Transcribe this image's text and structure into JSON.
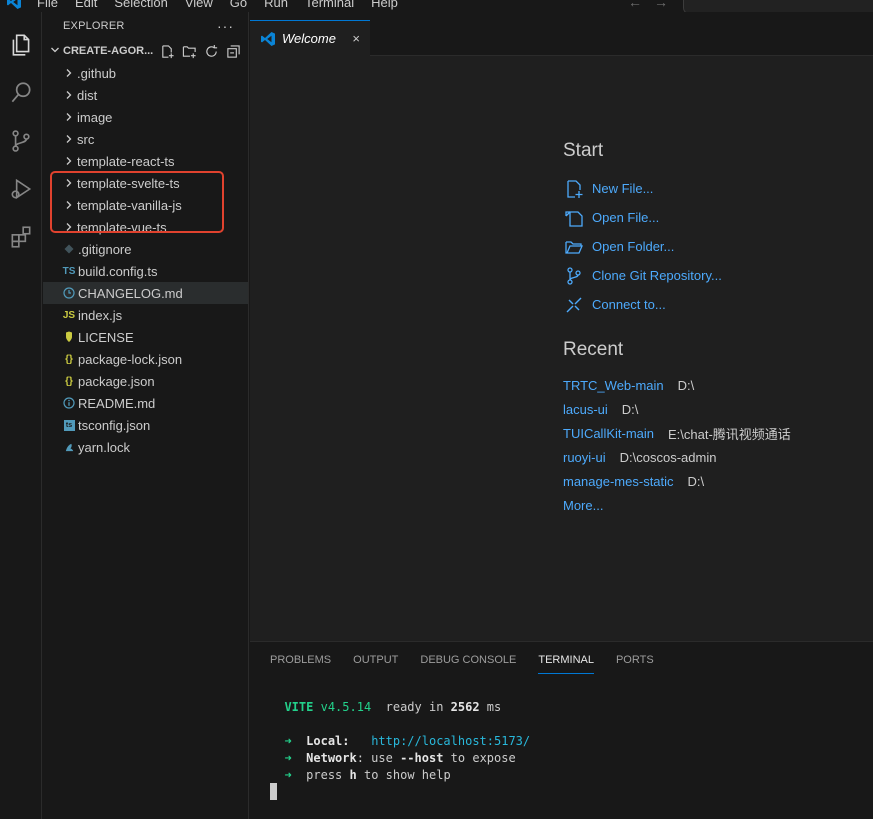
{
  "menu": [
    "File",
    "Edit",
    "Selection",
    "View",
    "Go",
    "Run",
    "Terminal",
    "Help"
  ],
  "explorer": {
    "header": "EXPLORER",
    "more": "···",
    "folder": "CREATE-AGOR...",
    "items": [
      {
        "label": ".github",
        "type": "folder"
      },
      {
        "label": "dist",
        "type": "folder"
      },
      {
        "label": "image",
        "type": "folder"
      },
      {
        "label": "src",
        "type": "folder"
      },
      {
        "label": "template-react-ts",
        "type": "folder"
      },
      {
        "label": "template-svelte-ts",
        "type": "folder"
      },
      {
        "label": "template-vanilla-js",
        "type": "folder"
      },
      {
        "label": "template-vue-ts",
        "type": "folder"
      },
      {
        "label": ".gitignore",
        "type": "file",
        "icon": "git-icon"
      },
      {
        "label": "build.config.ts",
        "type": "file",
        "icon": "TS"
      },
      {
        "label": "CHANGELOG.md",
        "type": "file",
        "icon": "clock-icon"
      },
      {
        "label": "index.js",
        "type": "file",
        "icon": "JS"
      },
      {
        "label": "LICENSE",
        "type": "file",
        "icon": "license-icon"
      },
      {
        "label": "package-lock.json",
        "type": "file",
        "icon": "{}"
      },
      {
        "label": "package.json",
        "type": "file",
        "icon": "{}"
      },
      {
        "label": "README.md",
        "type": "file",
        "icon": "info-icon"
      },
      {
        "label": "tsconfig.json",
        "type": "file",
        "icon": "ts"
      },
      {
        "label": "yarn.lock",
        "type": "file",
        "icon": "yarn-icon"
      }
    ]
  },
  "editor": {
    "tab_label": "Welcome",
    "tab_close": "×",
    "start_title": "Start",
    "start_items": [
      {
        "label": "New File...",
        "icon": "new-file-icon"
      },
      {
        "label": "Open File...",
        "icon": "open-file-icon"
      },
      {
        "label": "Open Folder...",
        "icon": "open-folder-icon"
      },
      {
        "label": "Clone Git Repository...",
        "icon": "git-clone-icon"
      },
      {
        "label": "Connect to...",
        "icon": "remote-icon"
      }
    ],
    "recent_title": "Recent",
    "recent_items": [
      {
        "name": "TRTC_Web-main",
        "path": "D:\\"
      },
      {
        "name": "lacus-ui",
        "path": "D:\\"
      },
      {
        "name": "TUICallKit-main",
        "path": "E:\\chat-腾讯视频通话"
      },
      {
        "name": "ruoyi-ui",
        "path": "D:\\coscos-admin"
      },
      {
        "name": "manage-mes-static",
        "path": "D:\\"
      }
    ],
    "more_label": "More..."
  },
  "panel": {
    "tabs": [
      "PROBLEMS",
      "OUTPUT",
      "DEBUG CONSOLE",
      "TERMINAL",
      "PORTS"
    ],
    "active_tab": "TERMINAL",
    "terminal": {
      "vite": "VITE",
      "version": "v4.5.14",
      "ready_text": "ready in",
      "ready_ms": "2562",
      "ms_unit": "ms",
      "arrow": "➜",
      "local_label": "Local:",
      "local_url": "http://localhost:5173/",
      "network_label": "Network",
      "network_text_1": ": use",
      "network_flag": "--host",
      "network_text_2": "to expose",
      "help_text_1": "press",
      "help_key": "h",
      "help_text_2": "to show help"
    }
  },
  "colors": {
    "accent": "#0078d4",
    "link": "#4daafc",
    "highlight": "#e0422e",
    "terminal_green": "#23d18b",
    "terminal_cyan": "#29b8db"
  }
}
